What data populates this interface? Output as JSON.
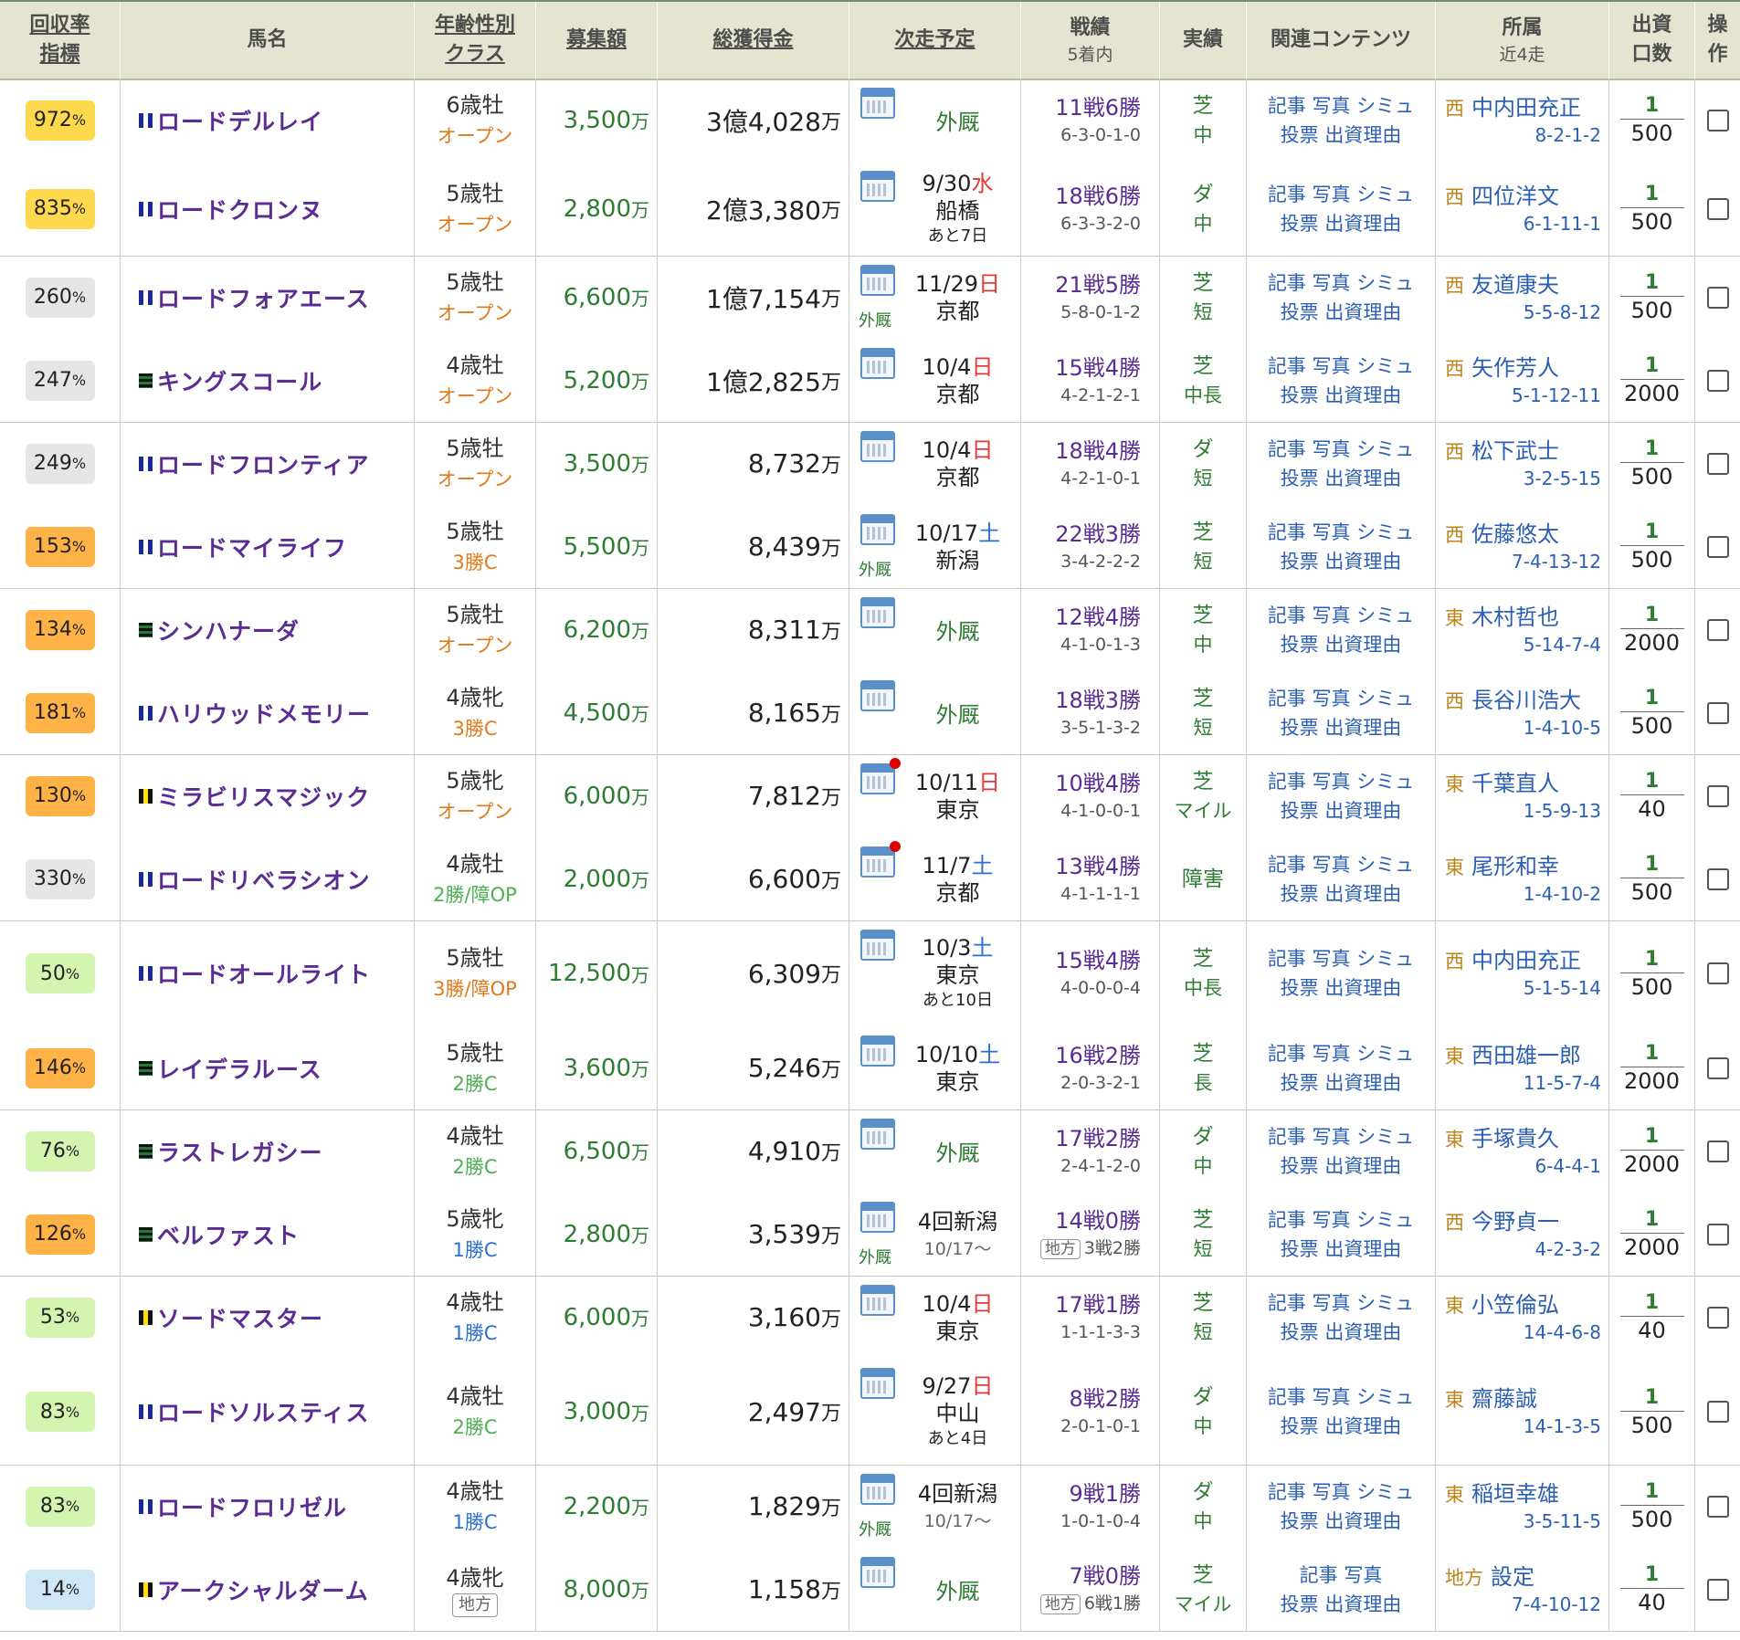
{
  "headers": {
    "kaishu": [
      "回収率",
      "指標"
    ],
    "uma": "馬名",
    "nenrei": [
      "年齢性別",
      "クラス"
    ],
    "boshu": "募集額",
    "soukakutoku": "総獲得金",
    "jisou": "次走予定",
    "senseki": [
      "戦績",
      "5着内"
    ],
    "jisseki": "実績",
    "kanren": "関連コンテンツ",
    "shozoku": [
      "所属",
      "近4走"
    ],
    "shusshi": [
      "出資",
      "口数"
    ],
    "sousa": [
      "操",
      "作"
    ]
  },
  "units": {
    "man": "万",
    "percent": "%"
  },
  "rows": [
    {
      "pct": "972",
      "pct_color": "#ffd94d",
      "flag": "blue",
      "name": "ロードデルレイ",
      "age": "6歳牡",
      "cls": "オープン",
      "cls_color": "orange",
      "boshu": "3,500",
      "prize": "3億4,028",
      "next": {
        "type": "gaikyu",
        "label": "外厩"
      },
      "rec1": "11戦6勝",
      "rec2": "6-3-0-1-0",
      "surface": "芝",
      "dist": "中",
      "links1": "記事 写真 シミュ",
      "links2": "投票 出資理由",
      "region": "西",
      "trainer": "中内田充正",
      "recent": "8-2-1-2",
      "num": "1",
      "den": "500"
    },
    {
      "pct": "835",
      "pct_color": "#ffd94d",
      "flag": "blue",
      "name": "ロードクロンヌ",
      "age": "5歳牡",
      "cls": "オープン",
      "cls_color": "orange",
      "boshu": "2,800",
      "prize": "2億3,380",
      "next": {
        "type": "race",
        "date": "9/30",
        "dow": "水",
        "dow_color": "sun",
        "place": "船橋",
        "note": "あと7日"
      },
      "rec1": "18戦6勝",
      "rec2": "6-3-3-2-0",
      "surface": "ダ",
      "dist": "中",
      "links1": "記事 写真 シミュ",
      "links2": "投票 出資理由",
      "region": "西",
      "trainer": "四位洋文",
      "recent": "6-1-11-1",
      "num": "1",
      "den": "500"
    },
    {
      "pct": "260",
      "pct_color": "#e6e6e6",
      "flag": "blue",
      "name": "ロードフォアエース",
      "age": "5歳牡",
      "cls": "オープン",
      "cls_color": "orange",
      "boshu": "6,600",
      "prize": "1億7,154",
      "next": {
        "type": "race",
        "date": "11/29",
        "dow": "日",
        "dow_color": "sun",
        "place": "京都",
        "small": "外厩"
      },
      "rec1": "21戦5勝",
      "rec2": "5-8-0-1-2",
      "surface": "芝",
      "dist": "短",
      "links1": "記事 写真 シミュ",
      "links2": "投票 出資理由",
      "region": "西",
      "trainer": "友道康夫",
      "recent": "5-5-8-12",
      "num": "1",
      "den": "500"
    },
    {
      "pct": "247",
      "pct_color": "#e6e6e6",
      "flag": "green",
      "name": "キングスコール",
      "age": "4歳牡",
      "cls": "オープン",
      "cls_color": "orange",
      "boshu": "5,200",
      "prize": "1億2,825",
      "next": {
        "type": "race",
        "date": "10/4",
        "dow": "日",
        "dow_color": "sun",
        "place": "京都"
      },
      "rec1": "15戦4勝",
      "rec2": "4-2-1-2-1",
      "surface": "芝",
      "dist": "中長",
      "links1": "記事 写真 シミュ",
      "links2": "投票 出資理由",
      "region": "西",
      "trainer": "矢作芳人",
      "recent": "5-1-12-11",
      "num": "1",
      "den": "2000"
    },
    {
      "pct": "249",
      "pct_color": "#e6e6e6",
      "flag": "blue",
      "name": "ロードフロンティア",
      "age": "5歳牡",
      "cls": "オープン",
      "cls_color": "orange",
      "boshu": "3,500",
      "prize": "8,732",
      "next": {
        "type": "race",
        "date": "10/4",
        "dow": "日",
        "dow_color": "sun",
        "place": "京都"
      },
      "rec1": "18戦4勝",
      "rec2": "4-2-1-0-1",
      "surface": "ダ",
      "dist": "短",
      "links1": "記事 写真 シミュ",
      "links2": "投票 出資理由",
      "region": "西",
      "trainer": "松下武士",
      "recent": "3-2-5-15",
      "num": "1",
      "den": "500"
    },
    {
      "pct": "153",
      "pct_color": "#ffb347",
      "flag": "blue",
      "name": "ロードマイライフ",
      "age": "5歳牡",
      "cls": "3勝C",
      "cls_color": "orange",
      "boshu": "5,500",
      "prize": "8,439",
      "next": {
        "type": "race",
        "date": "10/17",
        "dow": "土",
        "dow_color": "sat",
        "place": "新潟",
        "small": "外厩"
      },
      "rec1": "22戦3勝",
      "rec2": "3-4-2-2-2",
      "surface": "芝",
      "dist": "短",
      "links1": "記事 写真 シミュ",
      "links2": "投票 出資理由",
      "region": "西",
      "trainer": "佐藤悠太",
      "recent": "7-4-13-12",
      "num": "1",
      "den": "500"
    },
    {
      "pct": "134",
      "pct_color": "#ffb347",
      "flag": "green",
      "name": "シンハナーダ",
      "age": "5歳牡",
      "cls": "オープン",
      "cls_color": "orange",
      "boshu": "6,200",
      "prize": "8,311",
      "next": {
        "type": "gaikyu",
        "label": "外厩"
      },
      "rec1": "12戦4勝",
      "rec2": "4-1-0-1-3",
      "surface": "芝",
      "dist": "中",
      "links1": "記事 写真 シミュ",
      "links2": "投票 出資理由",
      "region": "東",
      "trainer": "木村哲也",
      "recent": "5-14-7-4",
      "num": "1",
      "den": "2000"
    },
    {
      "pct": "181",
      "pct_color": "#ffb347",
      "flag": "blue",
      "name": "ハリウッドメモリー",
      "age": "4歳牝",
      "cls": "3勝C",
      "cls_color": "orange",
      "boshu": "4,500",
      "prize": "8,165",
      "next": {
        "type": "gaikyu",
        "label": "外厩"
      },
      "rec1": "18戦3勝",
      "rec2": "3-5-1-3-2",
      "surface": "芝",
      "dist": "短",
      "links1": "記事 写真 シミュ",
      "links2": "投票 出資理由",
      "region": "西",
      "trainer": "長谷川浩大",
      "recent": "1-4-10-5",
      "num": "1",
      "den": "500"
    },
    {
      "pct": "130",
      "pct_color": "#ffb347",
      "flag": "yellow",
      "name": "ミラビリスマジック",
      "age": "5歳牝",
      "cls": "オープン",
      "cls_color": "orange",
      "boshu": "6,000",
      "prize": "7,812",
      "next": {
        "type": "race",
        "date": "10/11",
        "dow": "日",
        "dow_color": "sun",
        "place": "東京",
        "dot": true
      },
      "rec1": "10戦4勝",
      "rec2": "4-1-0-0-1",
      "surface": "芝",
      "dist": "マイル",
      "links1": "記事 写真 シミュ",
      "links2": "投票 出資理由",
      "region": "東",
      "trainer": "千葉直人",
      "recent": "1-5-9-13",
      "num": "1",
      "den": "40"
    },
    {
      "pct": "330",
      "pct_color": "#e6e6e6",
      "flag": "blue",
      "name": "ロードリベラシオン",
      "age": "4歳牡",
      "cls": "2勝/障OP",
      "cls_color": "green",
      "boshu": "2,000",
      "prize": "6,600",
      "next": {
        "type": "race",
        "date": "11/7",
        "dow": "土",
        "dow_color": "sat",
        "place": "京都",
        "dot": true
      },
      "rec1": "13戦4勝",
      "rec2": "4-1-1-1-1",
      "surface": "障害",
      "dist": "",
      "links1": "記事 写真 シミュ",
      "links2": "投票 出資理由",
      "region": "東",
      "trainer": "尾形和幸",
      "recent": "1-4-10-2",
      "num": "1",
      "den": "500"
    },
    {
      "pct": "50",
      "pct_color": "#d4f5b0",
      "flag": "blue",
      "name": "ロードオールライト",
      "age": "5歳牡",
      "cls": "3勝/障OP",
      "cls_color": "orange",
      "boshu": "12,500",
      "prize": "6,309",
      "next": {
        "type": "race",
        "date": "10/3",
        "dow": "土",
        "dow_color": "sat",
        "place": "東京",
        "note": "あと10日"
      },
      "rec1": "15戦4勝",
      "rec2": "4-0-0-0-4",
      "surface": "芝",
      "dist": "中長",
      "links1": "記事 写真 シミュ",
      "links2": "投票 出資理由",
      "region": "西",
      "trainer": "中内田充正",
      "recent": "5-1-5-14",
      "num": "1",
      "den": "500"
    },
    {
      "pct": "146",
      "pct_color": "#ffb347",
      "flag": "green",
      "name": "レイデラルース",
      "age": "5歳牡",
      "cls": "2勝C",
      "cls_color": "green",
      "boshu": "3,600",
      "prize": "5,246",
      "next": {
        "type": "race",
        "date": "10/10",
        "dow": "土",
        "dow_color": "sat",
        "place": "東京"
      },
      "rec1": "16戦2勝",
      "rec2": "2-0-3-2-1",
      "surface": "芝",
      "dist": "長",
      "links1": "記事 写真 シミュ",
      "links2": "投票 出資理由",
      "region": "東",
      "trainer": "西田雄一郎",
      "recent": "11-5-7-4",
      "num": "1",
      "den": "2000"
    },
    {
      "pct": "76",
      "pct_color": "#d4f5b0",
      "flag": "green",
      "name": "ラストレガシー",
      "age": "4歳牡",
      "cls": "2勝C",
      "cls_color": "green",
      "boshu": "6,500",
      "prize": "4,910",
      "next": {
        "type": "gaikyu",
        "label": "外厩"
      },
      "rec1": "17戦2勝",
      "rec2": "2-4-1-2-0",
      "surface": "ダ",
      "dist": "中",
      "links1": "記事 写真 シミュ",
      "links2": "投票 出資理由",
      "region": "東",
      "trainer": "手塚貴久",
      "recent": "6-4-4-1",
      "num": "1",
      "den": "2000"
    },
    {
      "pct": "126",
      "pct_color": "#ffb347",
      "flag": "green",
      "name": "ベルファスト",
      "age": "5歳牝",
      "cls": "1勝C",
      "cls_color": "blue",
      "boshu": "2,800",
      "prize": "3,539",
      "next": {
        "type": "kai",
        "label": "4回新潟",
        "sub": "10/17～",
        "small": "外厩"
      },
      "rec1": "14戦0勝",
      "rec2_chiho": "地方",
      "rec2": "3戦2勝",
      "surface": "芝",
      "dist": "短",
      "links1": "記事 写真 シミュ",
      "links2": "投票 出資理由",
      "region": "西",
      "trainer": "今野貞一",
      "recent": "4-2-3-2",
      "num": "1",
      "den": "2000"
    },
    {
      "pct": "53",
      "pct_color": "#d4f5b0",
      "flag": "yellow",
      "name": "ソードマスター",
      "age": "4歳牡",
      "cls": "1勝C",
      "cls_color": "blue",
      "boshu": "6,000",
      "prize": "3,160",
      "next": {
        "type": "race",
        "date": "10/4",
        "dow": "日",
        "dow_color": "sun",
        "place": "東京"
      },
      "rec1": "17戦1勝",
      "rec2": "1-1-1-3-3",
      "surface": "芝",
      "dist": "短",
      "links1": "記事 写真 シミュ",
      "links2": "投票 出資理由",
      "region": "東",
      "trainer": "小笠倫弘",
      "recent": "14-4-6-8",
      "num": "1",
      "den": "40"
    },
    {
      "pct": "83",
      "pct_color": "#d4f5b0",
      "flag": "blue",
      "name": "ロードソルスティス",
      "age": "4歳牡",
      "cls": "2勝C",
      "cls_color": "green",
      "boshu": "3,000",
      "prize": "2,497",
      "next": {
        "type": "race",
        "date": "9/27",
        "dow": "日",
        "dow_color": "sun",
        "place": "中山",
        "note": "あと4日"
      },
      "rec1": "8戦2勝",
      "rec2": "2-0-1-0-1",
      "surface": "ダ",
      "dist": "中",
      "links1": "記事 写真 シミュ",
      "links2": "投票 出資理由",
      "region": "東",
      "trainer": "齋藤誠",
      "recent": "14-1-3-5",
      "num": "1",
      "den": "500"
    },
    {
      "pct": "83",
      "pct_color": "#d4f5b0",
      "flag": "blue",
      "name": "ロードフロリゼル",
      "age": "4歳牡",
      "cls": "1勝C",
      "cls_color": "blue",
      "boshu": "2,200",
      "prize": "1,829",
      "next": {
        "type": "kai",
        "label": "4回新潟",
        "sub": "10/17～",
        "small": "外厩"
      },
      "rec1": "9戦1勝",
      "rec2": "1-0-1-0-4",
      "surface": "ダ",
      "dist": "中",
      "links1": "記事 写真 シミュ",
      "links2": "投票 出資理由",
      "region": "東",
      "trainer": "稲垣幸雄",
      "recent": "3-5-11-5",
      "num": "1",
      "den": "500"
    },
    {
      "pct": "14",
      "pct_color": "#cfe6f7",
      "flag": "yellow",
      "name": "アークシャルダーム",
      "age": "4歳牝",
      "cls": "地方",
      "cls_color": "chiho",
      "boshu": "8,000",
      "prize": "1,158",
      "next": {
        "type": "gaikyu",
        "label": "外厩"
      },
      "rec1": "7戦0勝",
      "rec2_chiho": "地方",
      "rec2": "6戦1勝",
      "surface": "芝",
      "dist": "マイル",
      "links1": "記事 写真",
      "links2": "投票 出資理由",
      "region": "地方",
      "trainer": "設定",
      "recent": "7-4-10-12",
      "num": "1",
      "den": "40"
    }
  ]
}
